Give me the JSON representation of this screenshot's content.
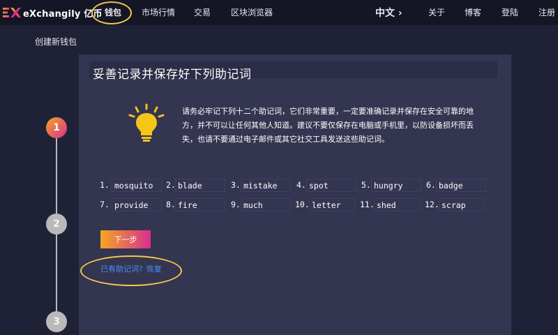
{
  "brand": {
    "name": "eXchangily 亿币"
  },
  "nav": {
    "items": [
      {
        "label": "钱包",
        "active": true
      },
      {
        "label": "市场行情"
      },
      {
        "label": "交易"
      },
      {
        "label": "区块浏览器"
      }
    ],
    "language": "中文 ›",
    "right_items": [
      {
        "label": "关于"
      },
      {
        "label": "博客"
      },
      {
        "label": "登陆"
      },
      {
        "label": "注册"
      }
    ]
  },
  "subheader": "创建新钱包",
  "steps": [
    "1",
    "2",
    "3"
  ],
  "card": {
    "title": "妥善记录并保存好下列助记词",
    "notice": "请务必牢记下列十二个助记词，它们非常重要，一定要准确记录并保存在安全可靠的地方，并不可以让任何其他人知道。建议不要仅保存在电脑或手机里，以防设备损坏而丢失，也请不要通过电子邮件或其它社交工具发送这些助记词。",
    "mnemonic": [
      {
        "num": "1.",
        "word": "mosquito"
      },
      {
        "num": "2.",
        "word": "blade"
      },
      {
        "num": "3.",
        "word": "mistake"
      },
      {
        "num": "4.",
        "word": "spot"
      },
      {
        "num": "5.",
        "word": "hungry"
      },
      {
        "num": "6.",
        "word": "badge"
      },
      {
        "num": "7.",
        "word": "provide"
      },
      {
        "num": "8.",
        "word": "fire"
      },
      {
        "num": "9.",
        "word": "much"
      },
      {
        "num": "10.",
        "word": "letter"
      },
      {
        "num": "11.",
        "word": "shed"
      },
      {
        "num": "12.",
        "word": "scrap"
      }
    ],
    "next_button": "下一步",
    "recover_question": "已有助记词?",
    "recover_link": "恢复"
  },
  "colors": {
    "background": "#1f2236",
    "navbar": "#141626",
    "card": "#343550",
    "accent_gradient_start": "#f4a623",
    "accent_gradient_end": "#d92f8e",
    "link": "#4d8ef7",
    "highlight": "#f2c84a"
  },
  "icons": {
    "logo": "exchangily-logo-icon",
    "bulb": "lightbulb-icon",
    "chevron": "chevron-right-icon"
  }
}
